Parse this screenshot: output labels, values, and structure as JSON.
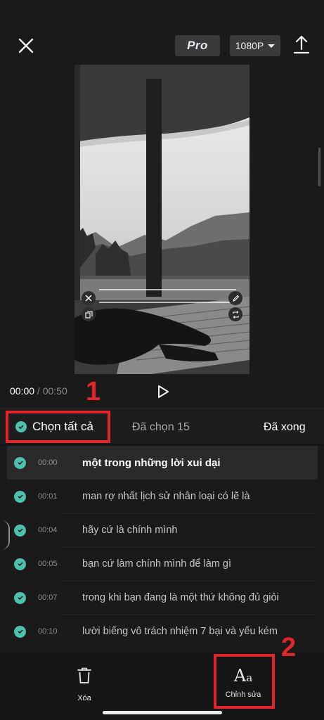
{
  "topbar": {
    "close_icon": "close-icon",
    "pro_label": "Pro",
    "resolution": "1080P",
    "export_icon": "upload-icon"
  },
  "player": {
    "current_time": "00:00",
    "separator": " / ",
    "total_time": "00:50",
    "play_icon": "play-icon",
    "overlay_icons": [
      "close-icon",
      "edit-pencil-icon",
      "copy-icon",
      "rotate-scale-icon"
    ]
  },
  "annotations": {
    "marker_1": "1",
    "marker_2": "2",
    "color": "#e0262a"
  },
  "selection_bar": {
    "select_all": "Chọn tất cả",
    "selected_count": "Đã chọn 15",
    "done": "Đã xong",
    "check_color": "#4fbfae"
  },
  "captions": [
    {
      "time": "00:00",
      "text": "một trong những lời xui dại"
    },
    {
      "time": "00:01",
      "text": "man rợ nhất lịch sử nhân loại có lẽ là"
    },
    {
      "time": "00:04",
      "text": "hãy cứ là chính mình"
    },
    {
      "time": "00:05",
      "text": "bạn cứ làm chính mình để làm gì"
    },
    {
      "time": "00:07",
      "text": "trong khi bạn đang là một thứ không đủ giỏi"
    },
    {
      "time": "00:10",
      "text": "lười biếng vô trách nhiệm 7 bại và yếu kém"
    }
  ],
  "bottom_tools": {
    "delete_label": "Xóa",
    "edit_label": "Chỉnh sửa",
    "delete_icon": "trash-icon",
    "edit_icon": "text-style-icon"
  }
}
